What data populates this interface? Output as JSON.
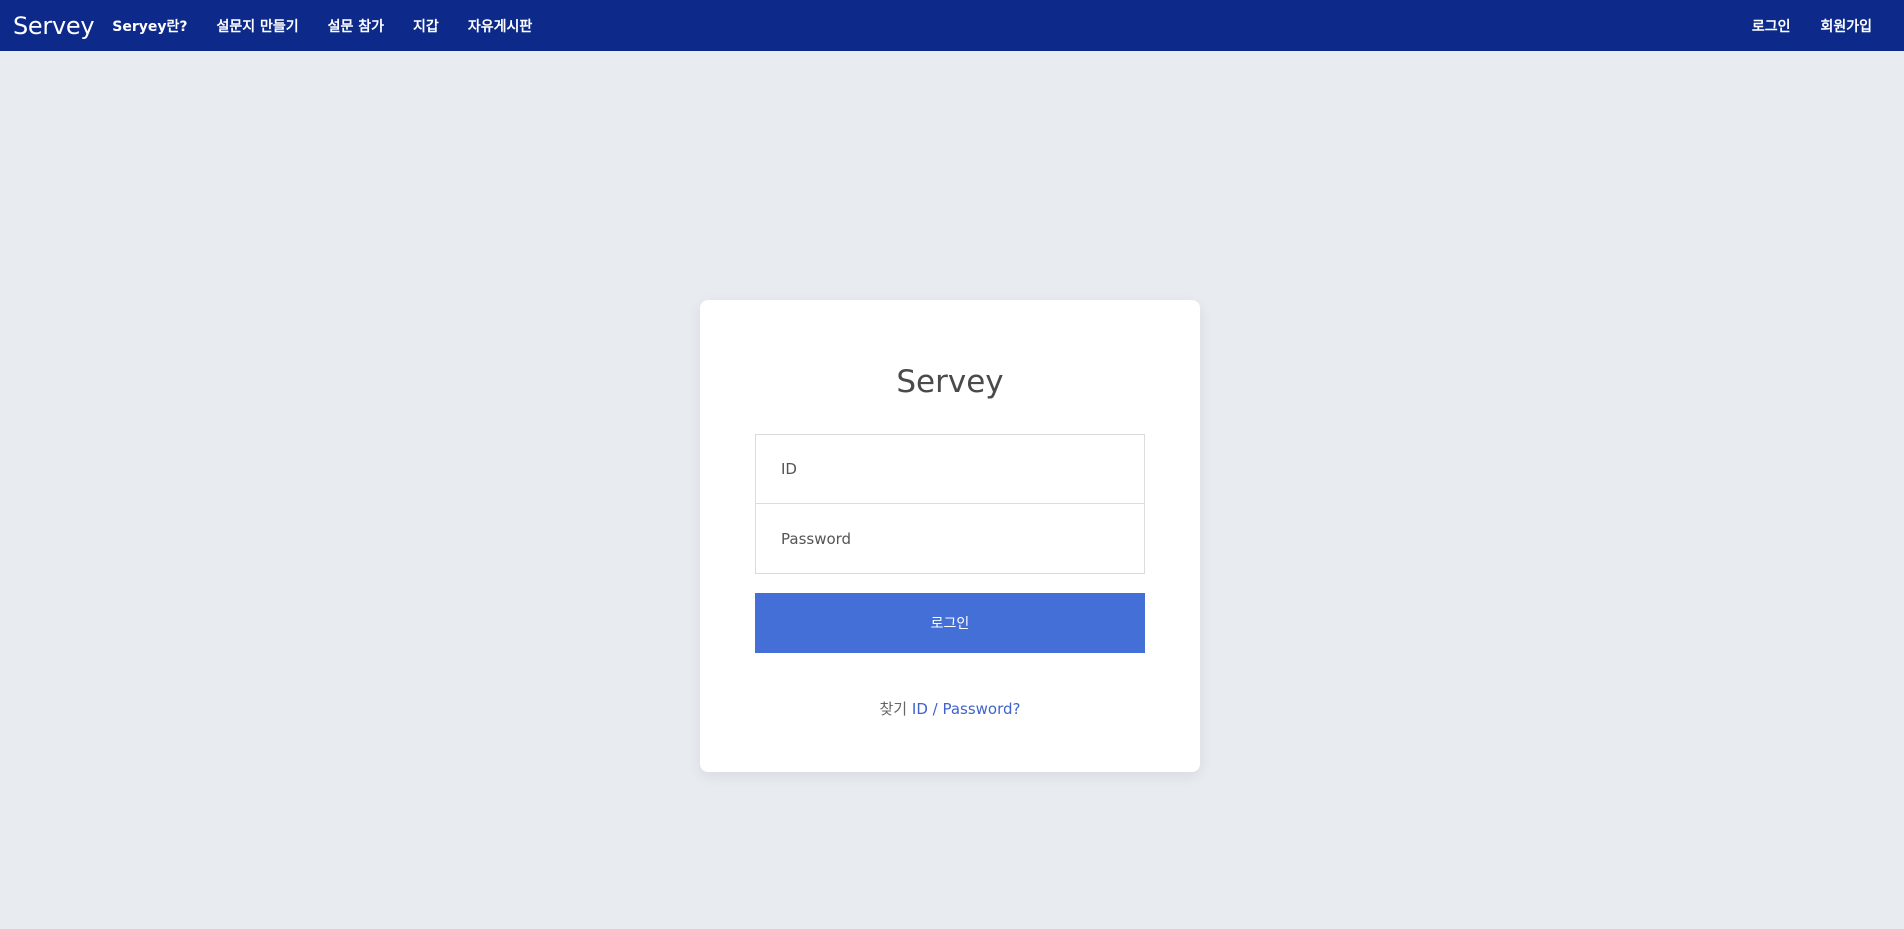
{
  "navbar": {
    "brand": "Servey",
    "links": [
      {
        "label": "Seryey란?"
      },
      {
        "label": "설문지 만들기"
      },
      {
        "label": "설문 참가"
      },
      {
        "label": "지갑"
      },
      {
        "label": "자유게시판"
      }
    ],
    "right_links": [
      {
        "label": "로그인"
      },
      {
        "label": "회원가입"
      }
    ],
    "bg_color": "#0d2a8a"
  },
  "login": {
    "title": "Servey",
    "id_placeholder": "ID",
    "password_placeholder": "Password",
    "submit_label": "로그인",
    "find_prefix": "찾기",
    "find_link": "ID / Password?",
    "button_color": "#436fd7"
  }
}
